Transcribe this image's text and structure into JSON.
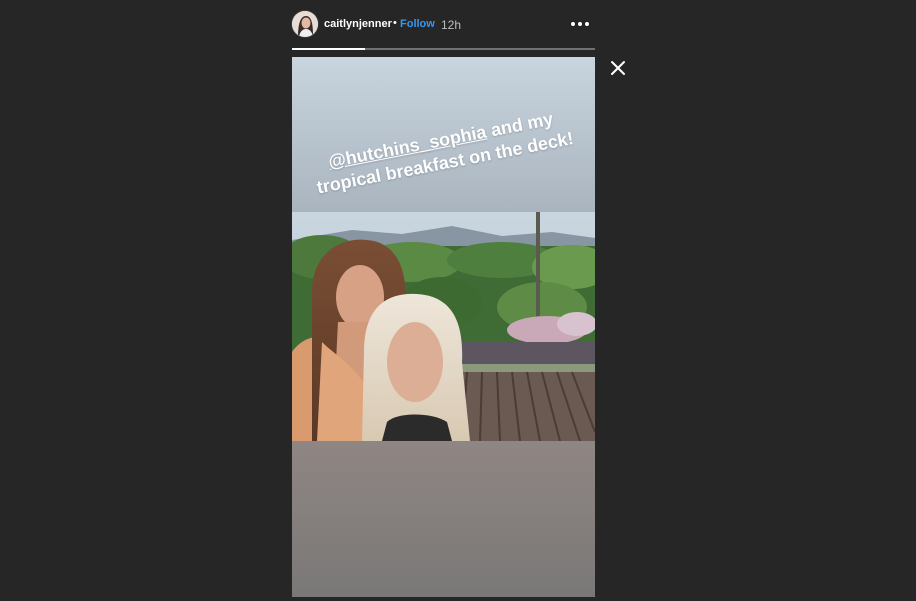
{
  "story": {
    "username": "caitlynjenner",
    "separator": "•",
    "follow_label": "Follow",
    "time_ago": "12h",
    "progress_fraction": 0.24,
    "caption": {
      "mention": "@hutchins_sophia",
      "text": "and my tropical breakfast on the deck!"
    }
  },
  "icons": {
    "more": "more-options-icon",
    "close": "close-icon"
  },
  "colors": {
    "background": "#262626",
    "follow": "#3897f0",
    "text": "#ffffff"
  }
}
